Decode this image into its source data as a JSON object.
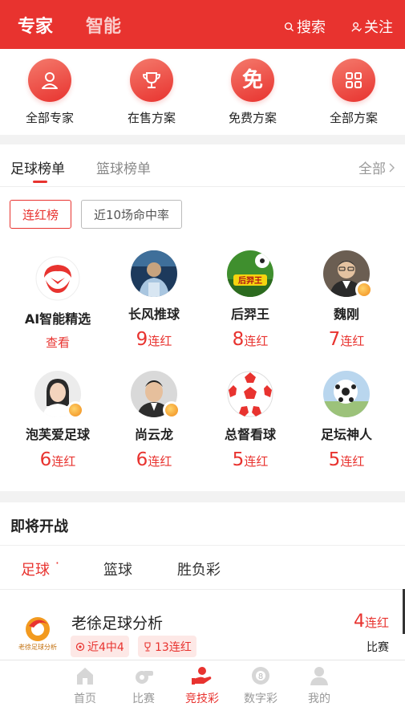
{
  "header": {
    "tabs": [
      {
        "label": "专家"
      },
      {
        "label": "智能"
      }
    ],
    "search_label": "搜索",
    "follow_label": "关注"
  },
  "quick_links": [
    {
      "label": "全部专家",
      "icon": "user-icon"
    },
    {
      "label": "在售方案",
      "icon": "trophy-icon"
    },
    {
      "label": "免费方案",
      "icon": "free-icon",
      "glyph": "免"
    },
    {
      "label": "全部方案",
      "icon": "grid-icon"
    }
  ],
  "ranking": {
    "tabs": [
      "足球榜单",
      "篮球榜单"
    ],
    "all_label": "全部",
    "filters": [
      "连红榜",
      "近10场命中率"
    ],
    "experts": [
      {
        "name": "AI智能精选",
        "action": "查看"
      },
      {
        "name": "长风推球",
        "streak_num": "9",
        "streak_unit": "连红"
      },
      {
        "name": "后羿王",
        "streak_num": "8",
        "streak_unit": "连红"
      },
      {
        "name": "魏刚",
        "streak_num": "7",
        "streak_unit": "连红"
      },
      {
        "name": "泡芙爱足球",
        "streak_num": "6",
        "streak_unit": "连红"
      },
      {
        "name": "尚云龙",
        "streak_num": "6",
        "streak_unit": "连红"
      },
      {
        "name": "总督看球",
        "streak_num": "5",
        "streak_unit": "连红"
      },
      {
        "name": "足坛神人",
        "streak_num": "5",
        "streak_unit": "连红"
      }
    ],
    "avatar_text_houyi": "后羿王"
  },
  "upcoming": {
    "title": "即将开战",
    "sport_tabs": [
      "足球",
      "篮球",
      "胜负彩"
    ],
    "card": {
      "name": "老徐足球分析",
      "logo_text": "老徐足球分析",
      "tag_hit": "近4中4",
      "tag_streak": "13连红",
      "streak_num": "4",
      "streak_unit": "连红",
      "match_label": "比赛"
    }
  },
  "nav": {
    "items": [
      {
        "label": "首页",
        "icon": "home-icon"
      },
      {
        "label": "比赛",
        "icon": "whistle-icon"
      },
      {
        "label": "竞技彩",
        "icon": "lottery-hand-icon"
      },
      {
        "label": "数字彩",
        "icon": "number-ball-icon"
      },
      {
        "label": "我的",
        "icon": "profile-icon"
      }
    ]
  },
  "colors": {
    "brand": "#e8332f",
    "tag_bg": "#fde8e6"
  }
}
